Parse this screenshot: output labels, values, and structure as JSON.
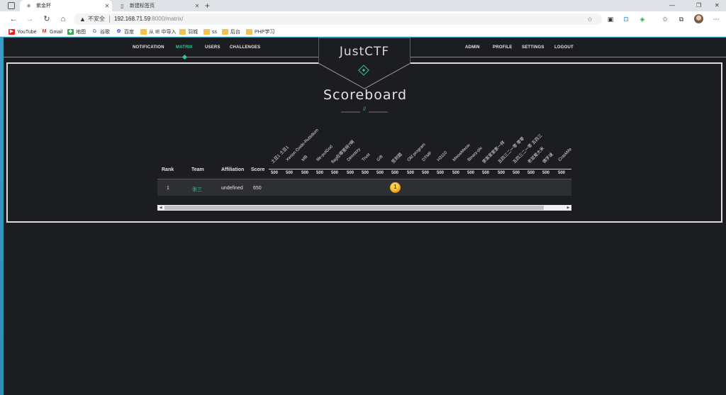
{
  "browser": {
    "tabs": [
      {
        "label": "紫金杯",
        "icon": "ctf-favicon-icon"
      },
      {
        "label": "新建标签页",
        "icon": "page-icon"
      }
    ],
    "url_warning": "不安全",
    "url_host": "192.168.71.59",
    "url_rest": ":8000/matrix/",
    "bookmarks": [
      "YouTube",
      "Gmail",
      "地图",
      "谷歌",
      "百度",
      "从 IE 中导入",
      "羽城",
      "ss",
      "后台",
      "PHP学习"
    ]
  },
  "nav": {
    "left": [
      "NOTIFICATION",
      "MATRIX",
      "USERS",
      "CHALLENGES"
    ],
    "active": "MATRIX",
    "right": [
      "ADMIN",
      "PROFILE",
      "SETTINGS",
      "LOGOUT"
    ]
  },
  "logo": "JustCTF",
  "title": "Scoreboard",
  "title_deco": "//",
  "table": {
    "headers": {
      "rank": "Rank",
      "team": "Team",
      "affiliation": "Affiliation",
      "score": "Score"
    },
    "challenges": [
      {
        "name": "土豆1 土豆1",
        "points": "500"
      },
      {
        "name": "Xenon Oxide-Rubidium",
        "points": "500"
      },
      {
        "name": "MB",
        "points": "500"
      },
      {
        "name": "file-putGod",
        "points": "500"
      },
      {
        "name": "flag在哪里呀?啊",
        "points": "500"
      },
      {
        "name": "Directory",
        "points": "500"
      },
      {
        "name": "Trust",
        "points": "500"
      },
      {
        "name": "Gift",
        "points": "500"
      },
      {
        "name": "签到题",
        "points": "500"
      },
      {
        "name": "Old program",
        "points": "500"
      },
      {
        "name": "DTMF",
        "points": "500"
      },
      {
        "name": "H3110",
        "points": "500"
      },
      {
        "name": "MeowMeow",
        "points": "500"
      },
      {
        "name": "Binary-pic",
        "points": "500"
      },
      {
        "name": "家家家家家一样",
        "points": "500"
      },
      {
        "name": "五四三二一零 零零",
        "points": "500"
      },
      {
        "name": "五四三二一零 五四三",
        "points": "500"
      },
      {
        "name": "老鼠爱大米",
        "points": "500"
      },
      {
        "name": "偶字谜",
        "points": "500"
      },
      {
        "name": "CrackMe",
        "points": "500"
      }
    ],
    "rows": [
      {
        "rank": "1",
        "team": "张三",
        "affiliation": "undefined",
        "score": "650",
        "solved_index": 8
      }
    ]
  },
  "colors": {
    "accent": "#33c6a0",
    "page_bg": "#1c1d20",
    "row_bg": "#2e2f32"
  }
}
